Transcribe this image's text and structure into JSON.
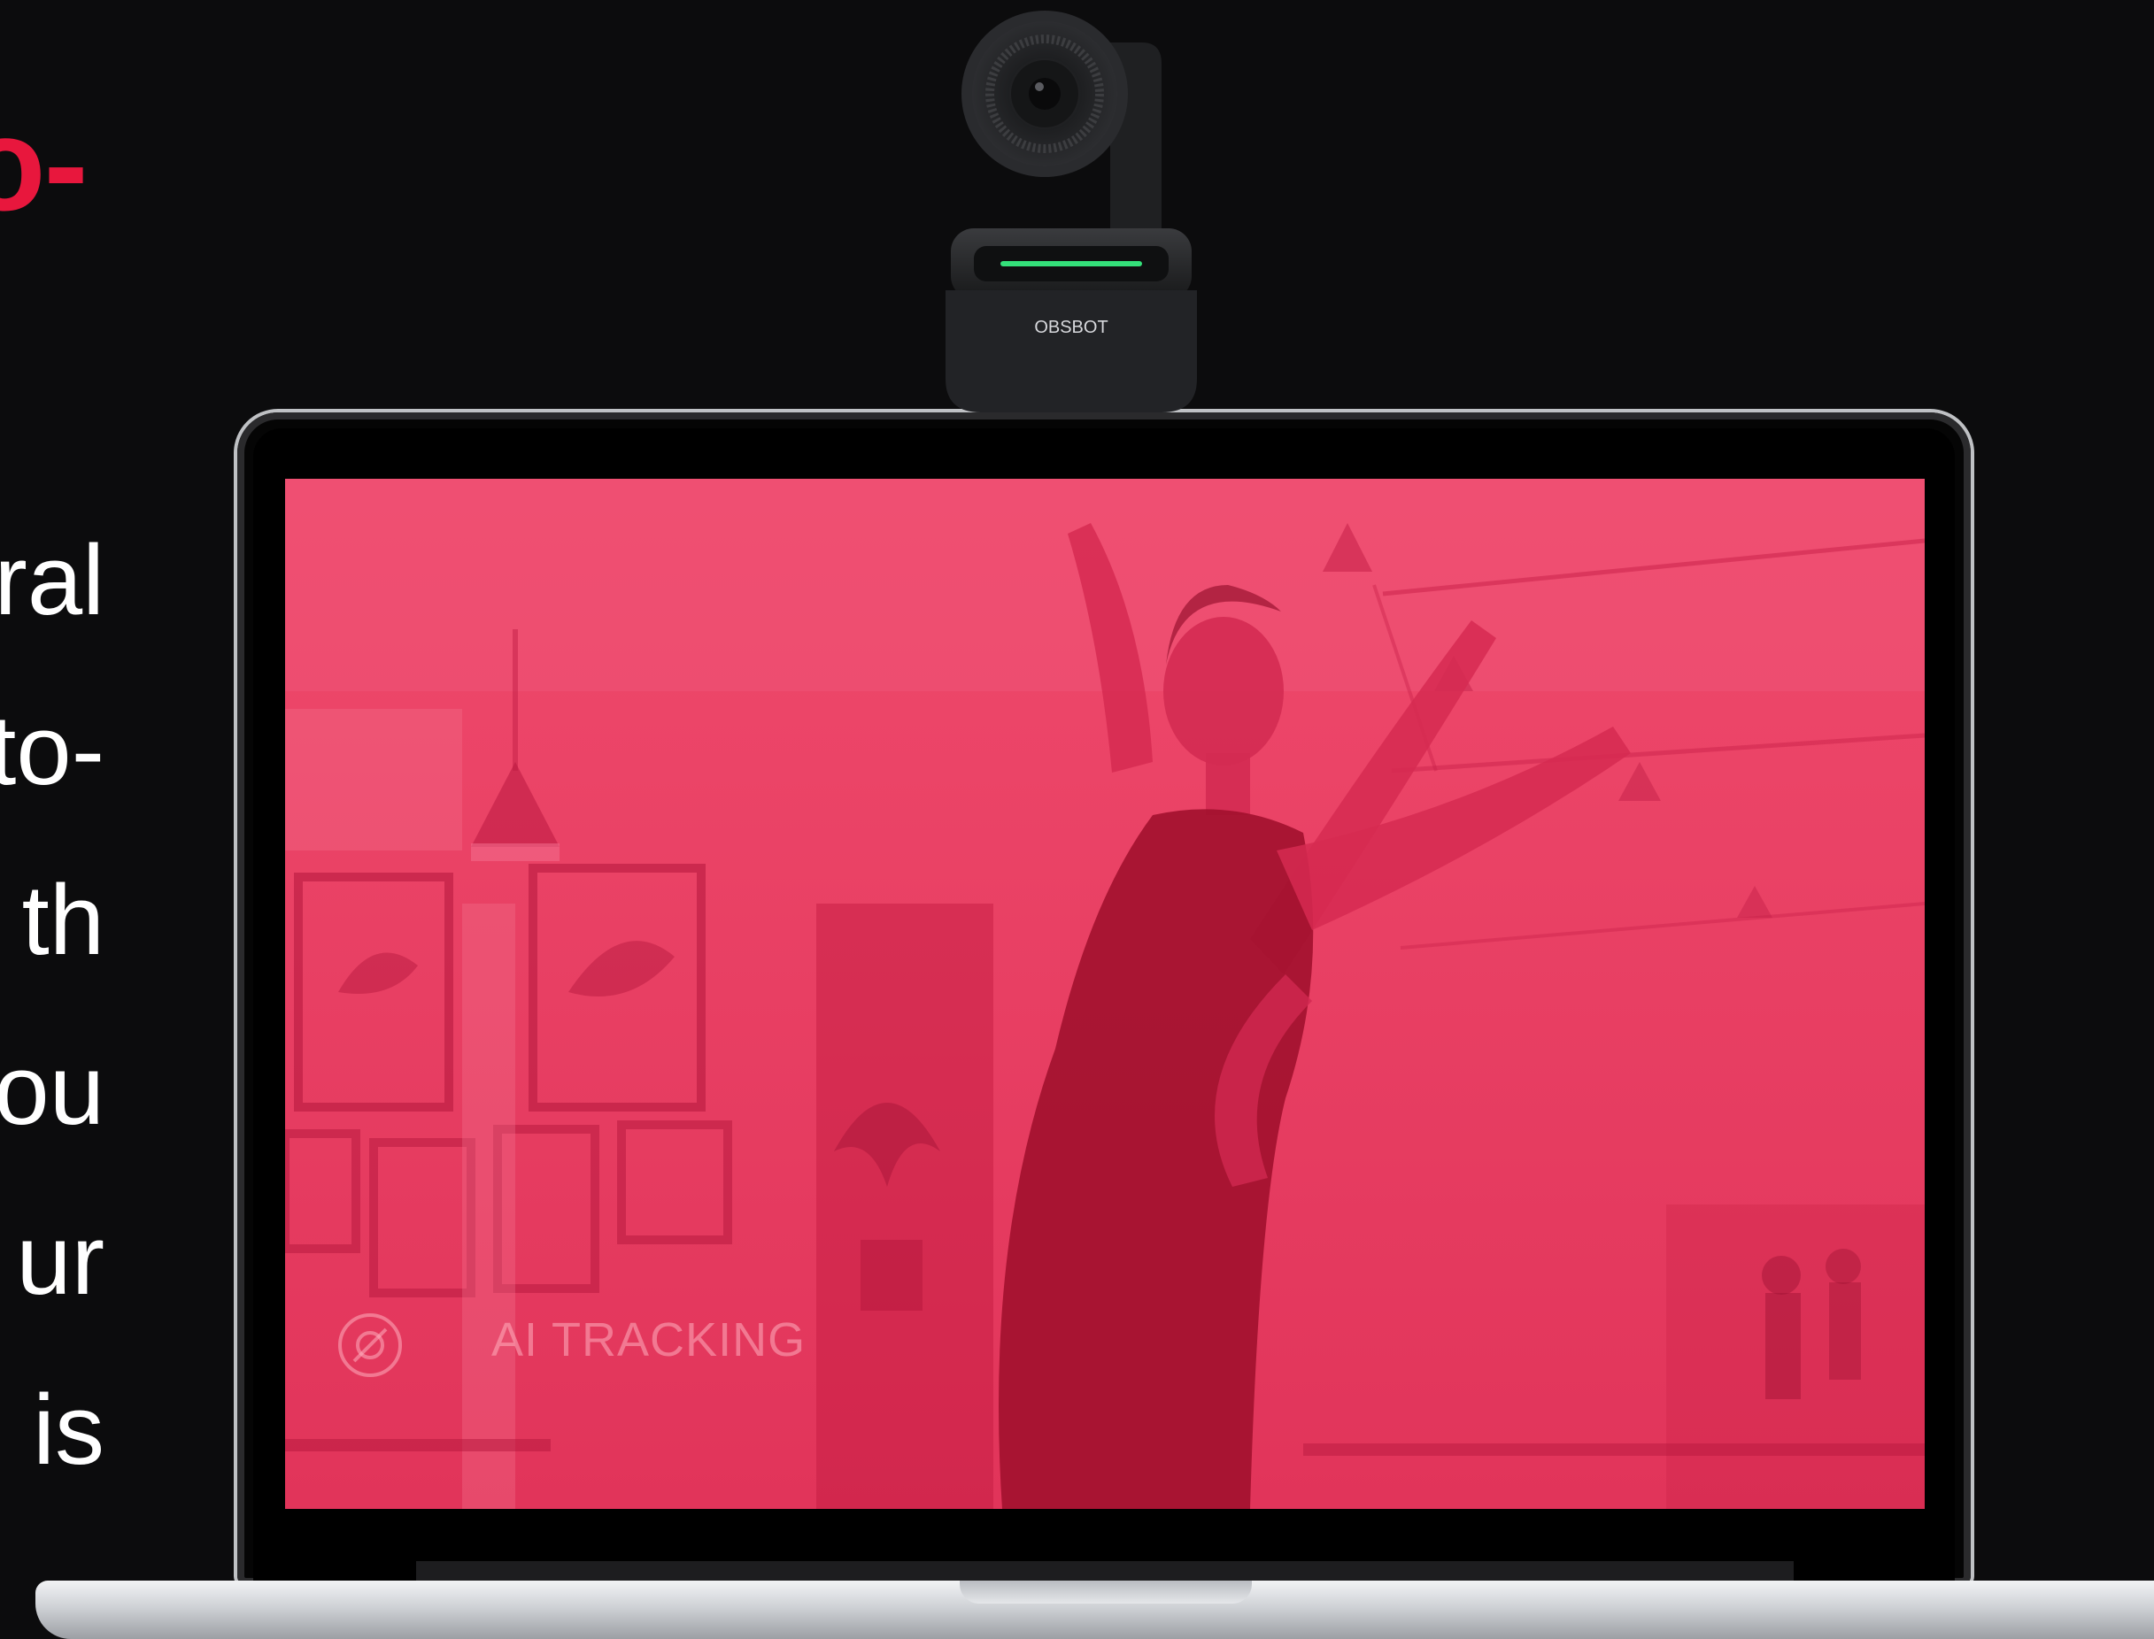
{
  "left_text": {
    "headline_fragment": "o-",
    "body_line_fragments": [
      "ral",
      "to-",
      "th",
      "ou",
      "ur",
      "is"
    ]
  },
  "webcam": {
    "brand_label": "OBSBOT",
    "status_light_color": "#34e07a"
  },
  "screen": {
    "overlay_label": "AI TRACKING",
    "tint_color": "#e8173d"
  },
  "colors": {
    "background": "#0c0c0d",
    "accent": "#e8173d",
    "body_text": "#ffffff"
  }
}
